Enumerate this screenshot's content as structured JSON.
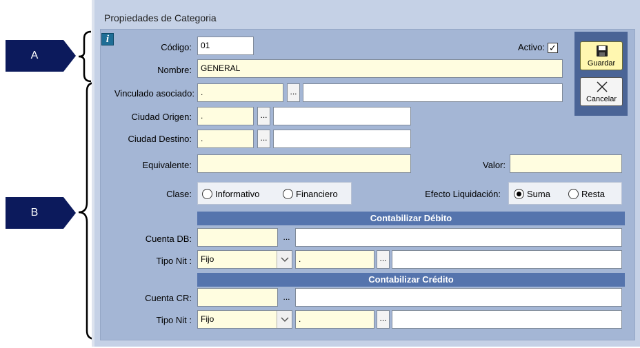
{
  "callouts": [
    {
      "id": "A",
      "label": "A"
    },
    {
      "id": "B",
      "label": "B"
    }
  ],
  "window": {
    "title": "Propiedades de Categoria"
  },
  "form": {
    "codigo": {
      "label": "Código:",
      "value": "01"
    },
    "activo": {
      "label": "Activo:",
      "checked": true,
      "check_glyph": "✓"
    },
    "nombre": {
      "label": "Nombre:",
      "value": "GENERAL"
    },
    "vinculado": {
      "label": "Vinculado asociado:",
      "code": ".",
      "description": ""
    },
    "ciudad_origen": {
      "label": "Ciudad Origen:",
      "code": ".",
      "description": ""
    },
    "ciudad_destino": {
      "label": "Ciudad Destino:",
      "code": ".",
      "description": ""
    },
    "equivalente": {
      "label": "Equivalente:",
      "value": ""
    },
    "valor": {
      "label": "Valor:",
      "value": ""
    },
    "clase": {
      "label": "Clase:",
      "options": [
        "Informativo",
        "Financiero"
      ],
      "selected": null
    },
    "efecto": {
      "label": "Efecto Liquidación:",
      "options": [
        "Suma",
        "Resta"
      ],
      "selected": "Suma"
    },
    "debito": {
      "header": "Contabilizar Débito",
      "cuenta_label": "Cuenta DB:",
      "cuenta_code": "",
      "cuenta_desc": "",
      "tipo_nit_label": "Tipo Nit :",
      "tipo_nit_value": "Fijo",
      "nit_code": ".",
      "nit_desc": ""
    },
    "credito": {
      "header": "Contabilizar Crédito",
      "cuenta_label": "Cuenta CR:",
      "cuenta_code": "",
      "cuenta_desc": "",
      "tipo_nit_label": "Tipo Nit :",
      "tipo_nit_value": "Fijo",
      "nit_code": ".",
      "nit_desc": ""
    },
    "dots_label": "..."
  },
  "toolbar": {
    "save_label": "Guardar",
    "cancel_label": "Cancelar"
  },
  "colors": {
    "callout": "#0c1a5c",
    "window_bg": "#c5d1e6",
    "form_bg": "#a4b6d5",
    "section_header": "#5574ad",
    "input_yellow": "#fffde0",
    "side_panel": "#4a6496"
  }
}
